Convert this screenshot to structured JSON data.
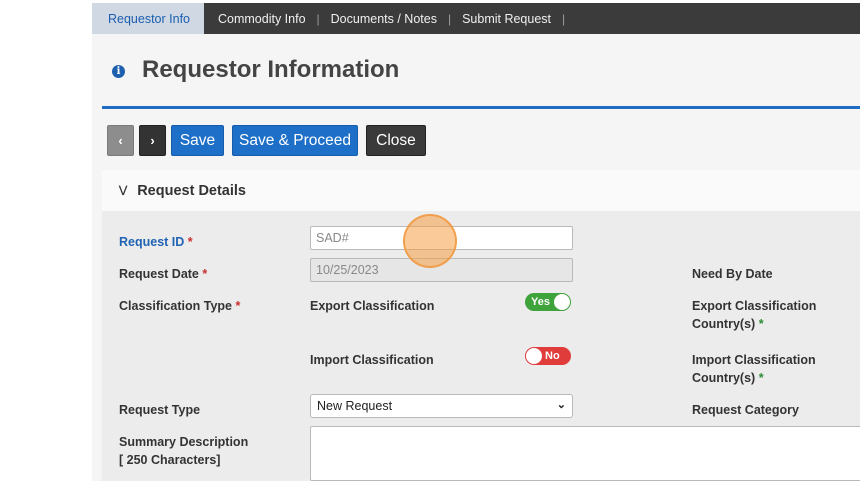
{
  "nav": {
    "tabs": [
      "Requestor Info",
      "Commodity Info",
      "Documents / Notes",
      "Submit Request"
    ],
    "separator": "|"
  },
  "header": {
    "title": "Requestor Information",
    "info_icon": "i"
  },
  "toolbar": {
    "prev": "‹",
    "next": "›",
    "save": "Save",
    "save_proceed": "Save & Proceed",
    "close": "Close"
  },
  "panel": {
    "title": "Request Details",
    "request_id": {
      "label": "Request ID",
      "placeholder": "SAD#"
    },
    "request_date": {
      "label": "Request Date",
      "value": "10/25/2023"
    },
    "need_by_date": {
      "label": "Need By Date"
    },
    "classification_type": {
      "label": "Classification Type"
    },
    "export_classification": {
      "label": "Export Classification",
      "toggle": "Yes"
    },
    "export_country": {
      "label_line1": "Export Classification",
      "label_line2": "Country(s)"
    },
    "import_classification": {
      "label": "Import Classification",
      "toggle": "No"
    },
    "import_country": {
      "label_line1": "Import Classification",
      "label_line2": "Country(s)"
    },
    "request_type": {
      "label": "Request Type",
      "selected": "New Request"
    },
    "request_category": {
      "label": "Request Category"
    },
    "summary": {
      "label_line1": "Summary Description",
      "label_line2": "[ 250 Characters]"
    },
    "required_mark": "*"
  },
  "colors": {
    "accent": "#1d6fc8",
    "nav_bg": "#3b3b3b",
    "toggle_on": "#3da33a",
    "toggle_off": "#e03c3c"
  }
}
